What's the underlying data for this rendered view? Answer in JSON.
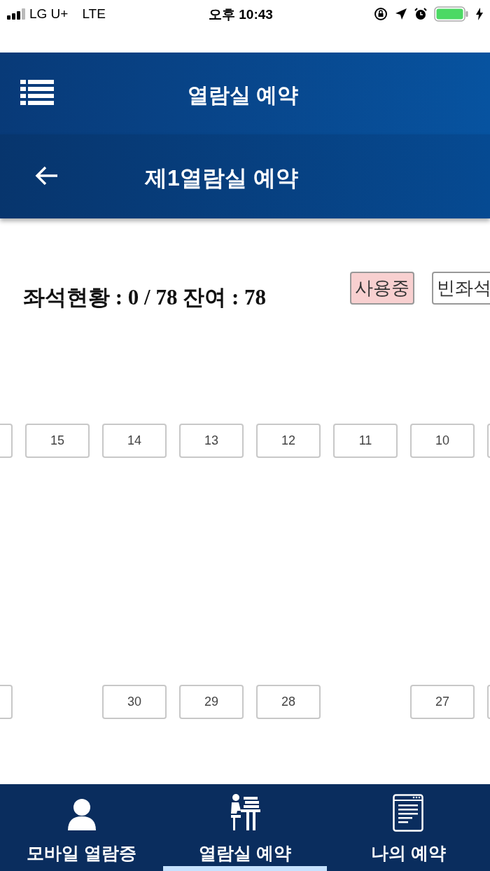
{
  "status_bar": {
    "carrier": "LG U+",
    "network": "LTE",
    "time": "오후 10:43"
  },
  "app_bar": {
    "title": "열람실 예약"
  },
  "sub_bar": {
    "title": "제1열람실 예약"
  },
  "seat_summary": "좌석현황 : 0 / 78 잔여 : 78",
  "legend": [
    {
      "label": "사용중",
      "color": "#f8d0d0"
    },
    {
      "label": "빈좌석",
      "color": "#ffffff"
    }
  ],
  "seat_rows": [
    [
      {
        "kind": "edge"
      },
      {
        "kind": "seat",
        "number": "15"
      },
      {
        "kind": "seat",
        "number": "14"
      },
      {
        "kind": "seat",
        "number": "13"
      },
      {
        "kind": "seat",
        "number": "12"
      },
      {
        "kind": "seat",
        "number": "11"
      },
      {
        "kind": "seat",
        "number": "10"
      },
      {
        "kind": "edge"
      }
    ],
    [
      {
        "kind": "edge"
      },
      {
        "kind": "gap"
      },
      {
        "kind": "seat",
        "number": "30"
      },
      {
        "kind": "seat",
        "number": "29"
      },
      {
        "kind": "seat",
        "number": "28"
      },
      {
        "kind": "gap"
      },
      {
        "kind": "seat",
        "number": "27"
      },
      {
        "kind": "edge"
      }
    ]
  ],
  "bottom_nav": [
    {
      "label": "모바일 열람증",
      "kind": "person",
      "selected": false
    },
    {
      "label": "열람실 예약",
      "kind": "desk",
      "selected": true
    },
    {
      "label": "나의 예약",
      "kind": "document",
      "selected": false
    }
  ]
}
